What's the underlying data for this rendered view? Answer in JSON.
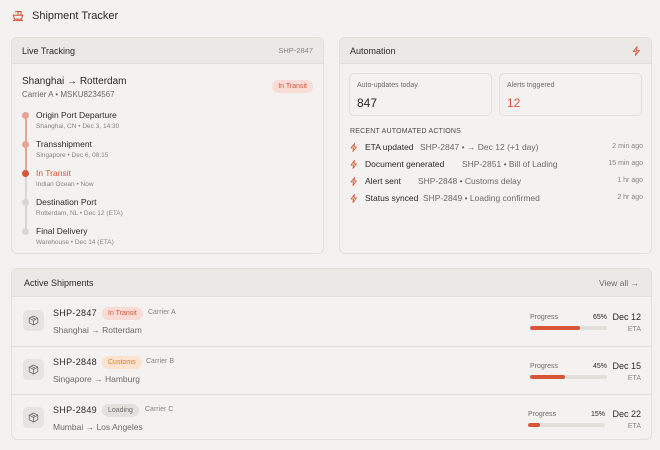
{
  "app": {
    "title": "Shipment Tracker",
    "logo_icon": "ship-icon",
    "accent": "#d8553a"
  },
  "live_tracking": {
    "title": "Live Tracking",
    "shipment_id": "SHP-2847",
    "route": "Shanghai → Rotterdam",
    "carrier_line": "Carrier A • MSKU8234567",
    "status": "In Transit",
    "steps": [
      {
        "name": "Origin Port Departure",
        "meta": "Shanghai, CN • Dec 3, 14:30",
        "state": "done"
      },
      {
        "name": "Transshipment",
        "meta": "Singapore • Dec 6, 08:15",
        "state": "done"
      },
      {
        "name": "In Transit",
        "meta": "Indian Ocean • Now",
        "state": "current"
      },
      {
        "name": "Destination Port",
        "meta": "Rotterdam, NL • Dec 12 (ETA)",
        "state": "pending"
      },
      {
        "name": "Final Delivery",
        "meta": "Warehouse • Dec 14 (ETA)",
        "state": "pending"
      }
    ]
  },
  "automation": {
    "title": "Automation",
    "header_icon": "bolt-icon",
    "stats": [
      {
        "label": "Auto-updates today",
        "value": "847"
      },
      {
        "label": "Alerts triggered",
        "value": "12"
      }
    ],
    "recent_label": "RECENT AUTOMATED ACTIONS",
    "actions": [
      {
        "name": "ETA updated",
        "detail": "SHP-2847 • → Dec 12 (+1 day)",
        "time": "2 min ago"
      },
      {
        "name": "Document generated",
        "detail": "SHP-2851 • Bill of Lading",
        "time": "15 min ago"
      },
      {
        "name": "Alert sent",
        "detail": "SHP-2848 • Customs delay",
        "time": "1 hr ago"
      },
      {
        "name": "Status synced",
        "detail": "SHP-2849 • Loading confirmed",
        "time": "2 hr ago"
      }
    ]
  },
  "active_shipments": {
    "title": "Active Shipments",
    "view_all": "View all →",
    "progress_label": "Progress",
    "eta_label": "ETA",
    "rows": [
      {
        "id": "SHP-2847",
        "status": "In Transit",
        "carrier": "Carrier A",
        "route": "Shanghai → Rotterdam",
        "progress": 65,
        "progress_text": "65%",
        "eta": "Dec 12"
      },
      {
        "id": "SHP-2848",
        "status": "Customs",
        "carrier": "Carrier B",
        "route": "Singapore → Hamburg",
        "progress": 45,
        "progress_text": "45%",
        "eta": "Dec 15"
      },
      {
        "id": "SHP-2849",
        "status": "Loading",
        "carrier": "Carrier C",
        "route": "Mumbai → Los Angeles",
        "progress": 15,
        "progress_text": "15%",
        "eta": "Dec 22"
      }
    ]
  }
}
